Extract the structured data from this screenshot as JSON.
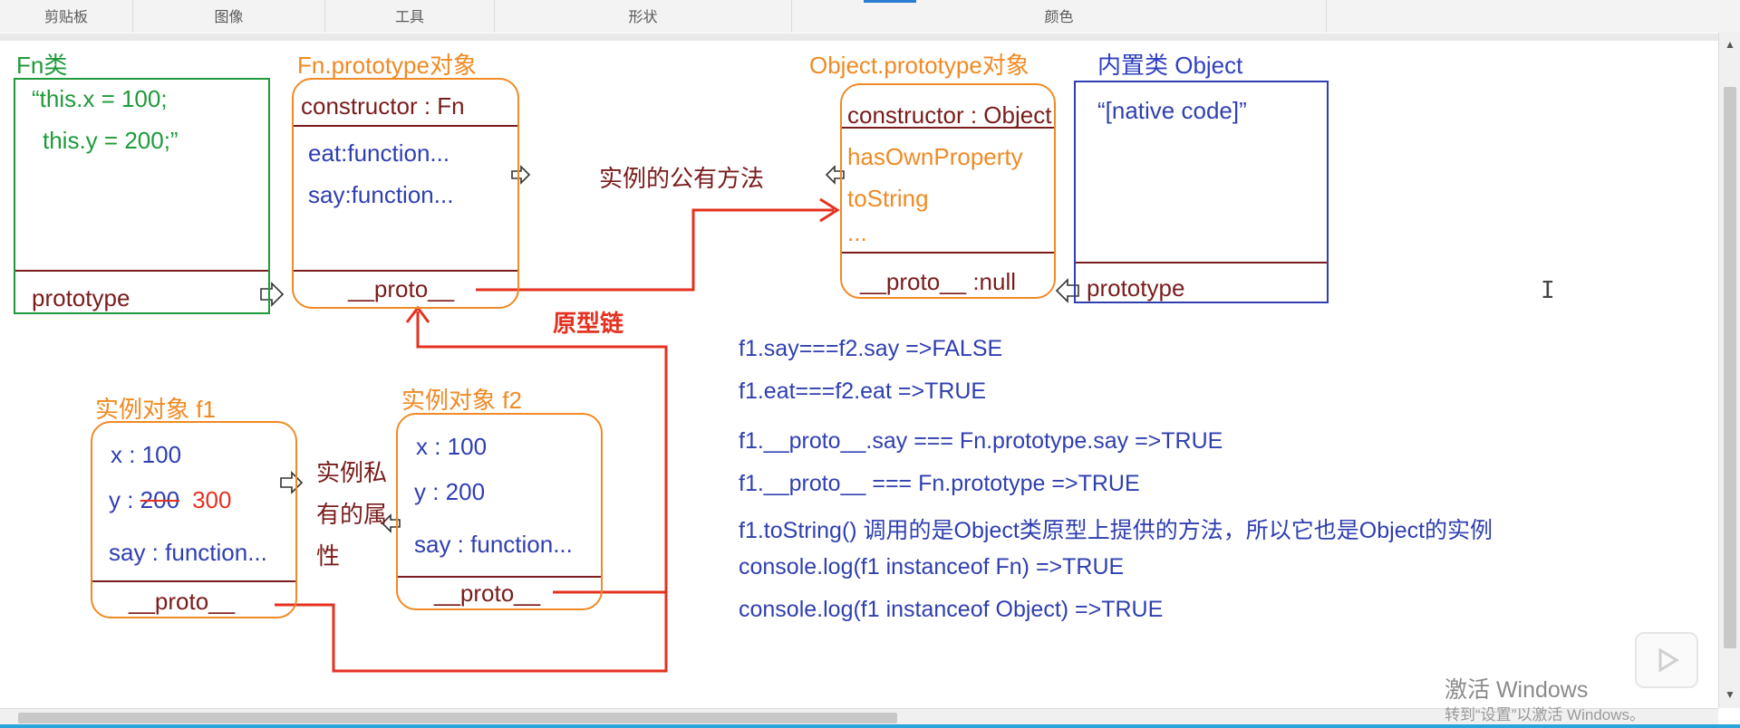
{
  "ribbon": {
    "groups": [
      "剪贴板",
      "图像",
      "工具",
      "形状",
      "颜色"
    ]
  },
  "labels": {
    "fn_class": "Fn类",
    "fn_prototype": "Fn.prototype对象",
    "object_prototype": "Object.prototype对象",
    "builtin_object": "内置类 Object",
    "instance_f1": "实例对象  f1",
    "instance_f2": "实例对象  f2",
    "prototype_chain": "原型链",
    "shared_methods": "实例的公有方法",
    "private_props_1": "实例私",
    "private_props_2": "有的属",
    "private_props_3": "性"
  },
  "fn_box": {
    "code_line1": "“this.x = 100;",
    "code_line2": "this.y = 200;”",
    "prototype": "prototype"
  },
  "fn_proto_box": {
    "constructor": "constructor : Fn",
    "eat": "eat:function...",
    "say": "say:function...",
    "proto": "__proto__"
  },
  "obj_proto_box": {
    "constructor": "constructor : Object",
    "has_own": "hasOwnProperty",
    "to_string": "toString",
    "ellipsis": "...",
    "proto": "__proto__ :null"
  },
  "object_box": {
    "native": "“[native code]”",
    "prototype": "prototype"
  },
  "f1_box": {
    "x": "x : 100",
    "y_prefix": "y : ",
    "y_old": "200",
    "y_new": "300",
    "say": "say : function...",
    "proto": "__proto__"
  },
  "f2_box": {
    "x": "x : 100",
    "y": "y : 200",
    "say": "say : function...",
    "proto": "__proto__"
  },
  "notes": [
    "f1.say===f2.say    =>FALSE",
    "f1.eat===f2.eat     =>TRUE",
    "f1.__proto__.say  === Fn.prototype.say    =>TRUE",
    "f1.__proto__ === Fn.prototype    =>TRUE",
    "f1.toString()    调用的是Object类原型上提供的方法，所以它也是Object的实例",
    "console.log(f1 instanceof Fn)    =>TRUE",
    "console.log(f1 instanceof Object)    =>TRUE"
  ],
  "watermark": {
    "line1": "激活 Windows",
    "line2": "转到“设置”以激活 Windows。"
  },
  "colors": {
    "orange": "#f08a24",
    "green": "#1e9a3a",
    "blue": "#2f3fb0",
    "maroon": "#7a1c1c",
    "red": "#e5311f"
  }
}
